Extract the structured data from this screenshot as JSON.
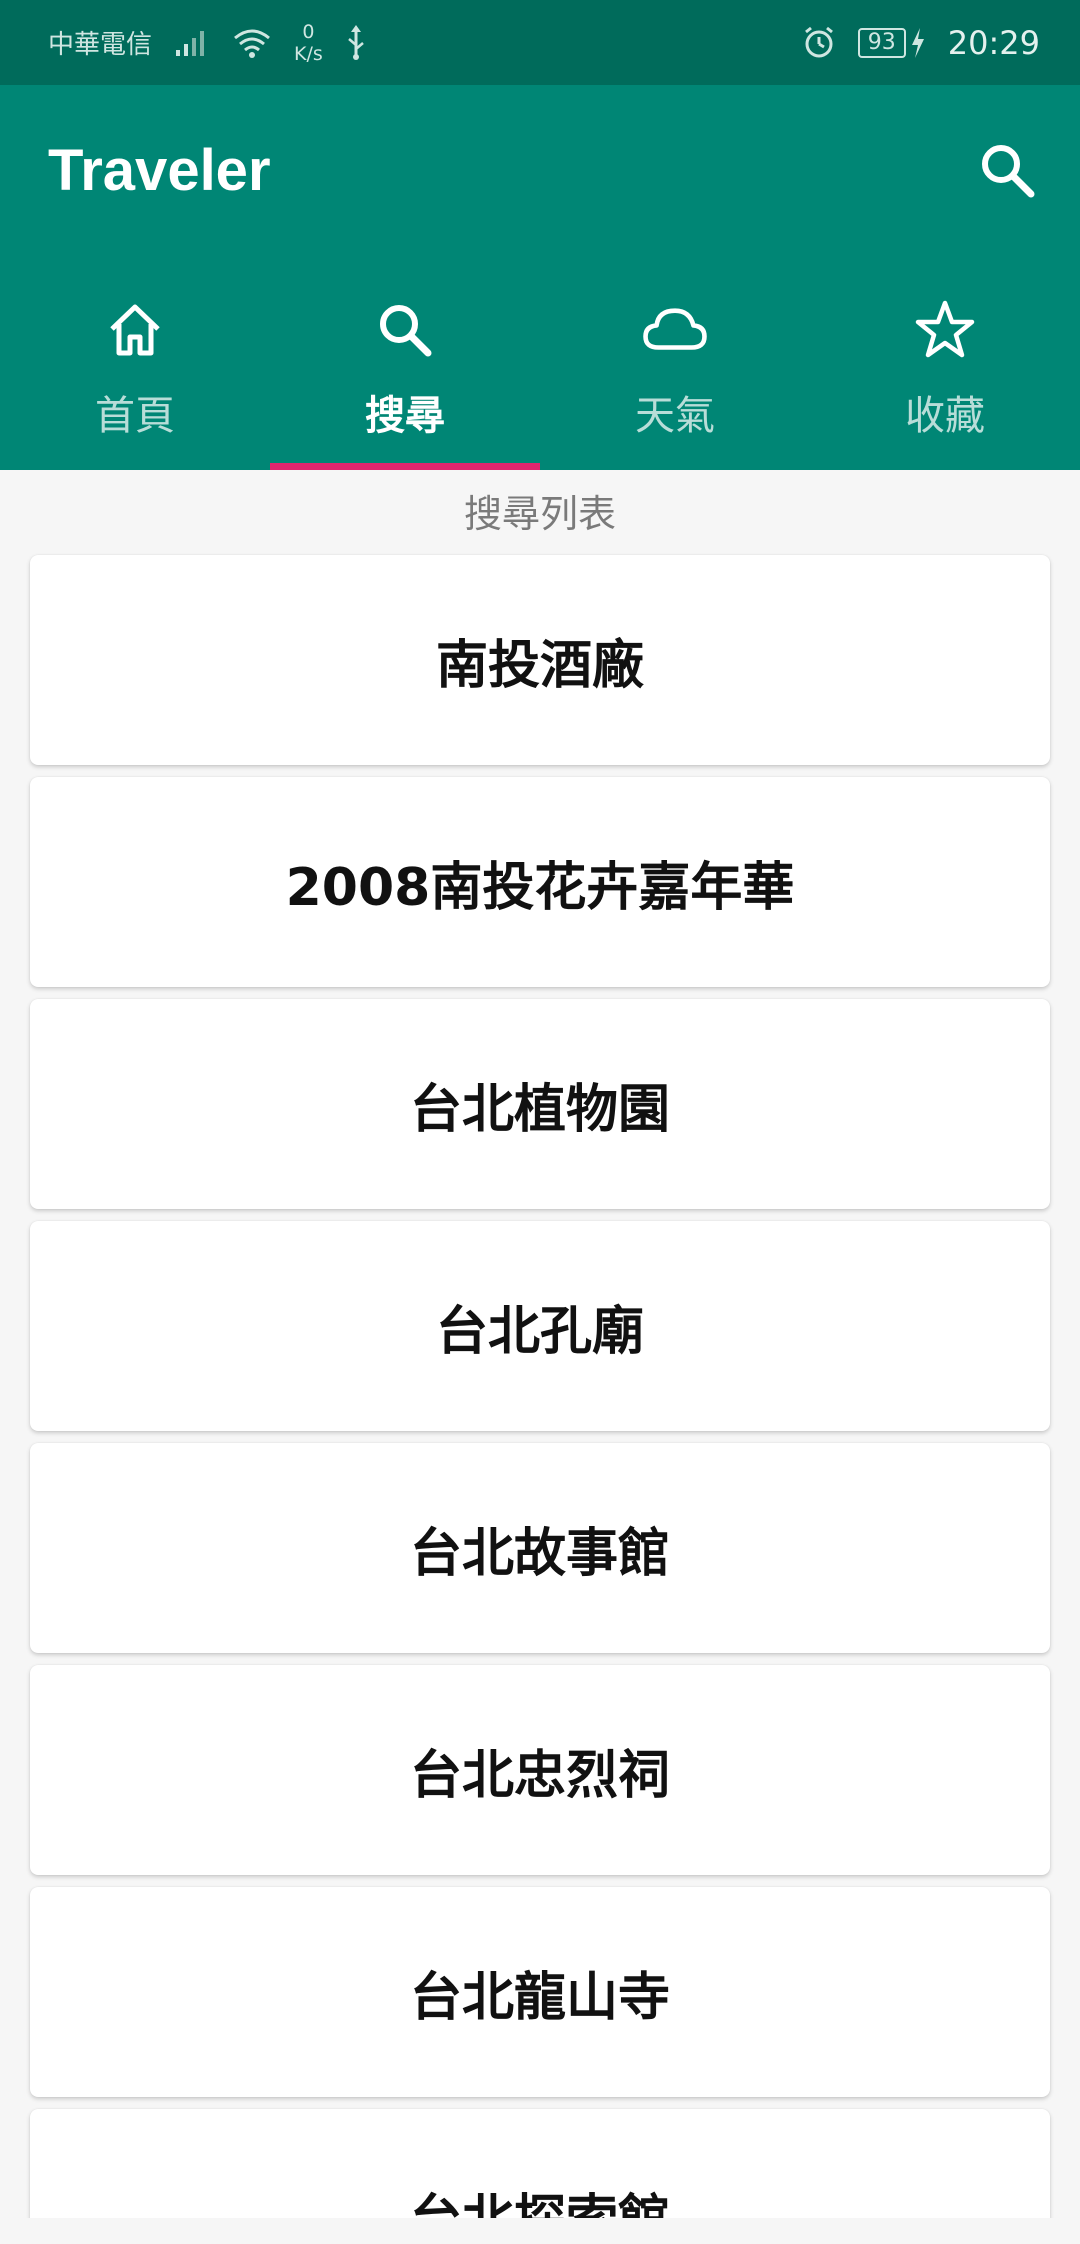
{
  "status_bar": {
    "carrier": "中華電信",
    "speed_value": "0",
    "speed_unit": "K/s",
    "battery": "93",
    "time": "20:29"
  },
  "app_bar": {
    "title": "Traveler",
    "search_icon": "search-icon"
  },
  "tabs": [
    {
      "label": "首頁",
      "icon": "home-icon",
      "active": false
    },
    {
      "label": "搜尋",
      "icon": "search-icon",
      "active": true
    },
    {
      "label": "天氣",
      "icon": "cloud-icon",
      "active": false
    },
    {
      "label": "收藏",
      "icon": "star-icon",
      "active": false
    }
  ],
  "list_heading": "搜尋列表",
  "results": [
    "南投酒廠",
    "2008南投花卉嘉年華",
    "台北植物園",
    "台北孔廟",
    "台北故事館",
    "台北忠烈祠",
    "台北龍山寺",
    "台北探索館"
  ],
  "colors": {
    "primary": "#008675",
    "status_bar": "#006b5b",
    "accent_indicator": "#e0266e"
  }
}
